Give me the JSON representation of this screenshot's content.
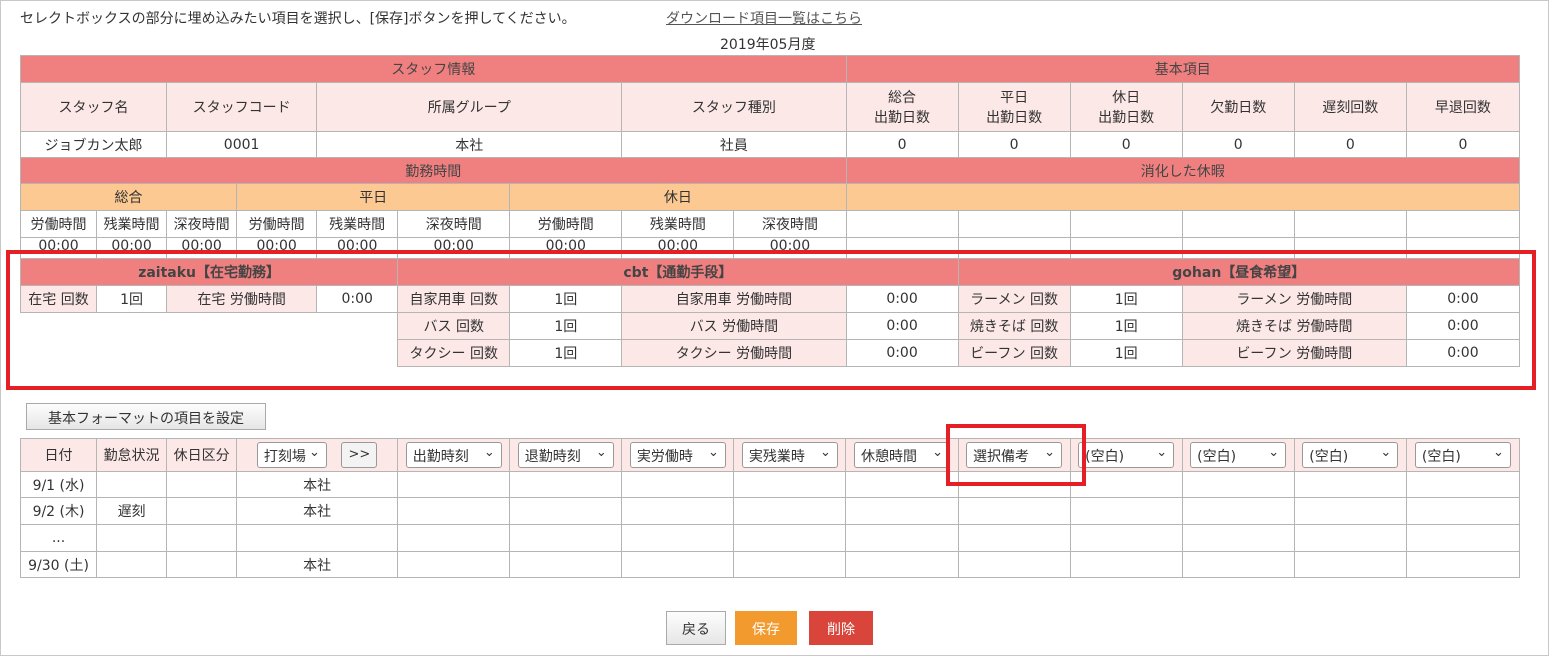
{
  "instruction": "セレクトボックスの部分に埋め込みたい項目を選択し、[保存]ボタンを押してください。",
  "download_link": "ダウンロード項目一覧はこちら",
  "month": "2019年05月度",
  "staff_section": {
    "title": "スタッフ情報",
    "headers": [
      "スタッフ名",
      "スタッフコード",
      "所属グループ",
      "スタッフ種別"
    ],
    "values": [
      "ジョブカン太郎",
      "0001",
      "本社",
      "社員"
    ]
  },
  "basic_section": {
    "title": "基本項目",
    "headers": [
      [
        "総合",
        "出勤日数"
      ],
      [
        "平日",
        "出勤日数"
      ],
      [
        "休日",
        "出勤日数"
      ],
      [
        "欠勤日数"
      ],
      [
        "遅刻回数"
      ],
      [
        "早退回数"
      ]
    ],
    "values": [
      "0",
      "0",
      "0",
      "0",
      "0",
      "0"
    ]
  },
  "work_section": {
    "title": "勤務時間",
    "groups": [
      "総合",
      "平日",
      "休日"
    ],
    "headers": [
      "労働時間",
      "残業時間",
      "深夜時間",
      "労働時間",
      "残業時間",
      "深夜時間",
      "労働時間",
      "残業時間",
      "深夜時間"
    ],
    "values": [
      "00:00",
      "00:00",
      "00:00",
      "00:00",
      "00:00",
      "00:00",
      "00:00",
      "00:00",
      "00:00"
    ]
  },
  "vacation_section": {
    "title": "消化した休暇"
  },
  "custom_groups": [
    {
      "title": "zaitaku【在宅勤務】"
    },
    {
      "title": "cbt【通勤手段】"
    },
    {
      "title": "gohan【昼食希望】"
    }
  ],
  "zaitaku": {
    "count_label": "在宅 回数",
    "count": "1回",
    "time_label": "在宅 労働時間",
    "time": "0:00"
  },
  "cbt_rows": [
    {
      "count_label": "自家用車 回数",
      "count": "1回",
      "time_label": "自家用車 労働時間",
      "time": "0:00"
    },
    {
      "count_label": "バス 回数",
      "count": "1回",
      "time_label": "バス 労働時間",
      "time": "0:00"
    },
    {
      "count_label": "タクシー 回数",
      "count": "1回",
      "time_label": "タクシー 労働時間",
      "time": "0:00"
    }
  ],
  "gohan_rows": [
    {
      "count_label": "ラーメン 回数",
      "count": "1回",
      "time_label": "ラーメン 労働時間",
      "time": "0:00"
    },
    {
      "count_label": "焼きそば 回数",
      "count": "1回",
      "time_label": "焼きそば 労働時間",
      "time": "0:00"
    },
    {
      "count_label": "ビーフン 回数",
      "count": "1回",
      "time_label": "ビーフン 労働時間",
      "time": "0:00"
    }
  ],
  "set_format_button": "基本フォーマットの項目を設定",
  "daily": {
    "headers": [
      "日付",
      "勤怠状況",
      "休日区分"
    ],
    "punch_select": "打刻場",
    "toggle": ">>",
    "selects": [
      "出勤時刻",
      "退勤時刻",
      "実労働時",
      "実残業時",
      "休憩時間",
      "選択備考",
      "(空白)",
      "(空白)",
      "(空白)",
      "(空白)"
    ],
    "rows": [
      {
        "date": "9/1 (水)",
        "status": "",
        "holiday": "",
        "punch": "本社"
      },
      {
        "date": "9/2 (木)",
        "status": "遅刻",
        "holiday": "",
        "punch": "本社"
      },
      {
        "date": "...",
        "status": "",
        "holiday": "",
        "punch": ""
      },
      {
        "date": "9/30 (土)",
        "status": "",
        "holiday": "",
        "punch": "本社"
      }
    ]
  },
  "buttons": {
    "back": "戻る",
    "save": "保存",
    "delete": "削除"
  },
  "colors": {
    "header_red": "#f08080",
    "header_pink": "#fde8e8",
    "header_orange": "#fcc993",
    "highlight": "#e41f26",
    "save": "#f39a2e",
    "delete": "#d9443b"
  }
}
